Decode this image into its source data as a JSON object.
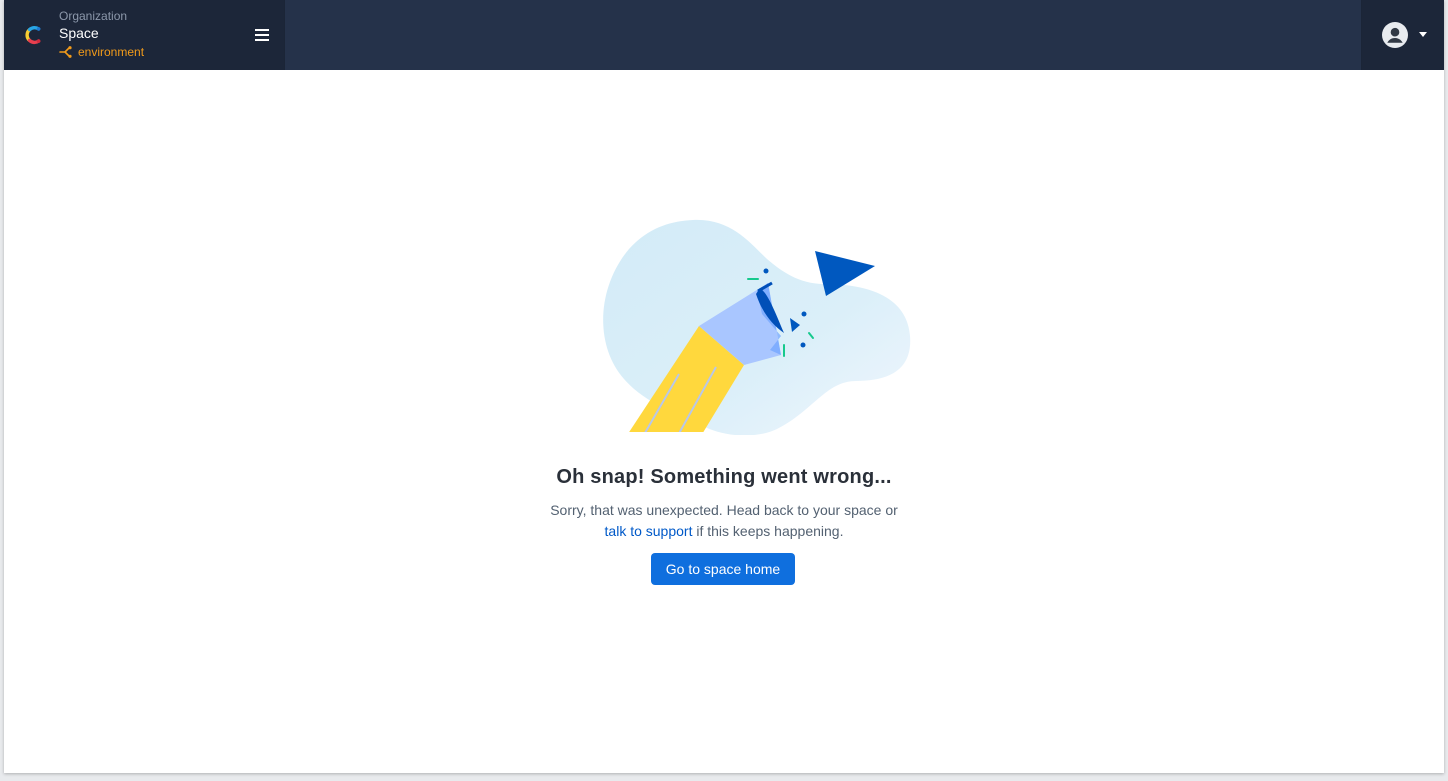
{
  "header": {
    "organization_label": "Organization",
    "space_label": "Space",
    "environment_label": "environment",
    "logo_icon": "contentful-logo-icon",
    "menu_icon": "hamburger-menu-icon",
    "account_icon": "user-avatar-icon",
    "account_caret_icon": "caret-down-icon"
  },
  "error": {
    "illustration_icon": "broken-pencil-illustration",
    "title": "Oh snap! Something went wrong...",
    "message_before_link": "Sorry, that was unexpected. Head back to your space or",
    "support_link_label": "talk to support",
    "message_after_link": "if this keeps happening.",
    "button_label": "Go to space home"
  },
  "colors": {
    "topbar": "#25324a",
    "sidebar_header": "#1c2639",
    "environment": "#f29b1a",
    "primary_button": "#0f6fde",
    "link": "#0059c8"
  }
}
